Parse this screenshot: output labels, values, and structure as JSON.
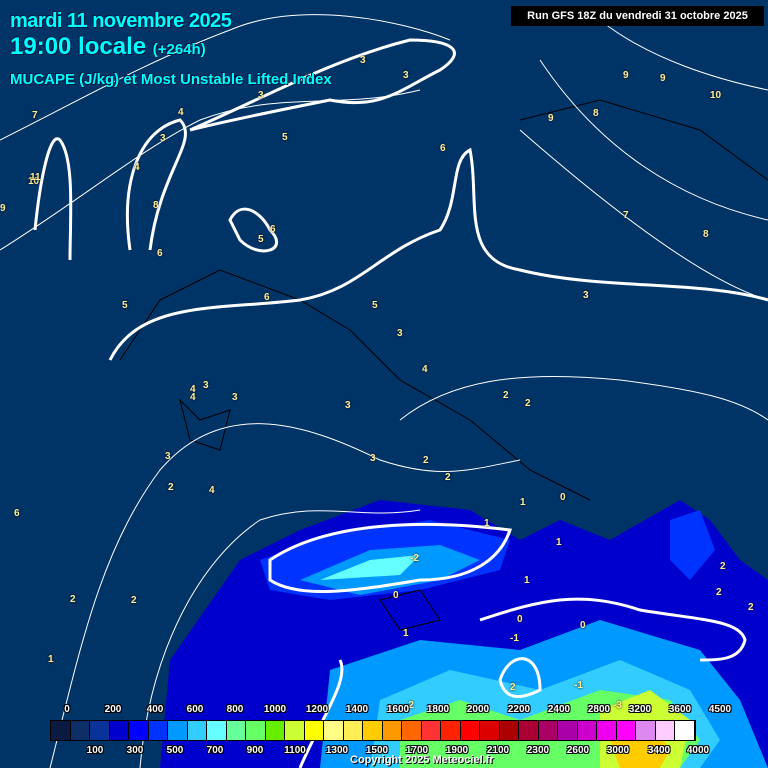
{
  "header": {
    "date": "mardi 11 novembre 2025",
    "time": "19:00 locale",
    "lead": "(+264h)",
    "parameter": "MUCAPE (J/kg) et Most Unstable Lifted Index",
    "run": "Run GFS 18Z du vendredi 31 octobre 2025"
  },
  "legend": {
    "colors": [
      "#0b1a40",
      "#0d2e66",
      "#0a3399",
      "#0000cc",
      "#0000ff",
      "#0033ff",
      "#0099ff",
      "#33ccff",
      "#66ffff",
      "#66ff99",
      "#66ff66",
      "#66ee00",
      "#ccff33",
      "#ffff00",
      "#ffff88",
      "#ffee55",
      "#ffcc00",
      "#ff9900",
      "#ff6600",
      "#ff3333",
      "#ff2200",
      "#ff0000",
      "#dd0000",
      "#aa0000",
      "#aa0033",
      "#aa0066",
      "#aa00aa",
      "#cc00cc",
      "#ee00ee",
      "#ff00ff",
      "#dd88ee",
      "#ffccff",
      "#ffffff"
    ],
    "top_labels": [
      "0",
      "200",
      "400",
      "600",
      "800",
      "1000",
      "1200",
      "1400",
      "1600",
      "1800",
      "2000",
      "2200",
      "2400",
      "2800",
      "3200",
      "3600",
      "4500"
    ],
    "bottom_labels": [
      "100",
      "300",
      "500",
      "700",
      "900",
      "1100",
      "1300",
      "1500",
      "1700",
      "1900",
      "2100",
      "2300",
      "2600",
      "3000",
      "3400",
      "4000"
    ]
  },
  "contour_labels": [
    "3",
    "3",
    "3",
    "5",
    "6",
    "4",
    "3",
    "4",
    "8",
    "6",
    "5",
    "6",
    "5",
    "5",
    "6",
    "9",
    "9",
    "10",
    "9",
    "8",
    "7",
    "8",
    "3",
    "3",
    "4",
    "4",
    "3",
    "3",
    "2",
    "2",
    "2",
    "3",
    "2",
    "2",
    "1",
    "0",
    "1",
    "1",
    "-2",
    "0",
    "1",
    "0",
    "-1",
    "0",
    "2",
    "-1",
    "-3",
    "-2",
    "1",
    "2",
    "2",
    "2",
    "6",
    "2",
    "3",
    "2",
    "4",
    "3",
    "1",
    "10",
    "9",
    "11",
    "7",
    "4"
  ],
  "copyright": "Copyright 2025 Meteociel.fr"
}
